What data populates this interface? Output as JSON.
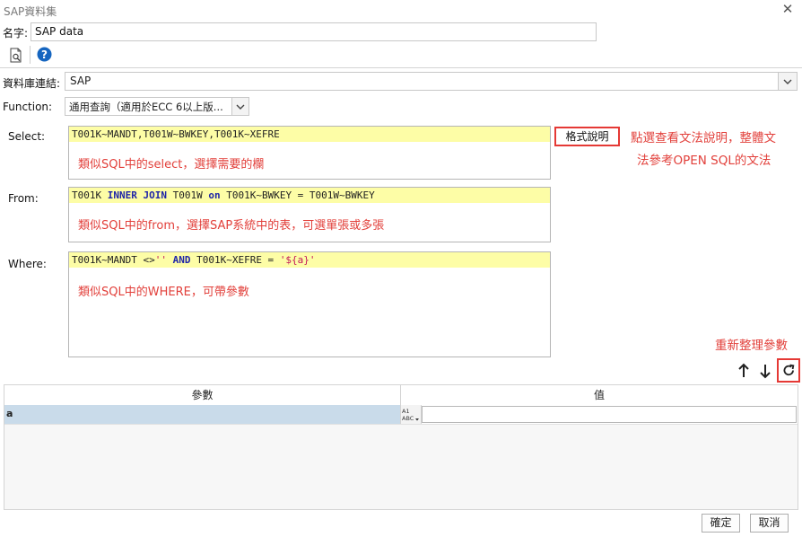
{
  "window": {
    "title": "SAP資料集"
  },
  "name": {
    "label": "名字:",
    "value": "SAP data"
  },
  "toolbar": {
    "preview_icon": "document-preview-icon",
    "help_icon": "help-icon"
  },
  "connection": {
    "label": "資料庫連結:",
    "value": "SAP"
  },
  "function": {
    "label": "Function:",
    "value": "通用查詢（適用於ECC 6以上版..."
  },
  "select": {
    "label": "Select:",
    "code": "T001K~MANDT,T001W~BWKEY,T001K~XEFRE",
    "annotation": "類似SQL中的select，選擇需要的欄"
  },
  "from": {
    "label": "From:",
    "code_parts": [
      "T001K ",
      "INNER JOIN",
      " T001W ",
      "on",
      " T001K~BWKEY = T001W~BWKEY"
    ],
    "annotation": "類似SQL中的from，選擇SAP系統中的表，可選單張或多張"
  },
  "where": {
    "label": "Where:",
    "code_parts": [
      "T001K~MANDT <>",
      "''",
      " ",
      "AND",
      " T001K~XEFRE = ",
      "'${a}'"
    ],
    "annotation": "類似SQL中的WHERE，可帶參數"
  },
  "format_button": {
    "label": "格式說明"
  },
  "format_annotation": {
    "line1": "點選查看文法說明，整體文",
    "line2": "法參考OPEN SQL的文法"
  },
  "refresh_annotation": "重新整理參數",
  "params_table": {
    "columns": [
      "參數",
      "值"
    ],
    "rows": [
      {
        "name": "a",
        "value": ""
      }
    ]
  },
  "footer": {
    "ok_label": "確定",
    "cancel_label": "取消"
  },
  "colors": {
    "highlight_line": "#fdfda6",
    "annotation": "#e2403b",
    "keyword": "#1f25a8",
    "string": "#c2185b",
    "selected_row": "#c9dbea"
  }
}
